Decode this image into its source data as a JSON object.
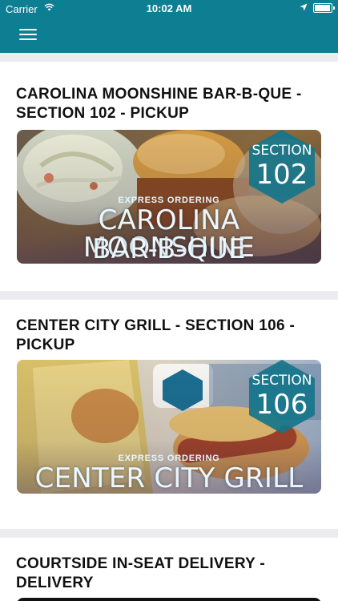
{
  "status_bar": {
    "carrier": "Carrier",
    "time": "10:02 AM"
  },
  "cards": [
    {
      "title": "CAROLINA MOONSHINE BAR-B-QUE - SECTION 102 - PICKUP",
      "banner": {
        "express": "EXPRESS ORDERING",
        "name_line1": "CAROLINA MOONSHINE",
        "name_line2": "BAR-B-QUE",
        "section_label": "SECTION",
        "section_number": "102"
      }
    },
    {
      "title": "CENTER CITY GRILL - SECTION 106 - PICKUP",
      "banner": {
        "express": "EXPRESS ORDERING",
        "name_line1": "CENTER CITY GRILL",
        "section_label": "SECTION",
        "section_number": "106"
      }
    },
    {
      "title": "COURTSIDE IN-SEAT DELIVERY - DELIVERY"
    }
  ]
}
